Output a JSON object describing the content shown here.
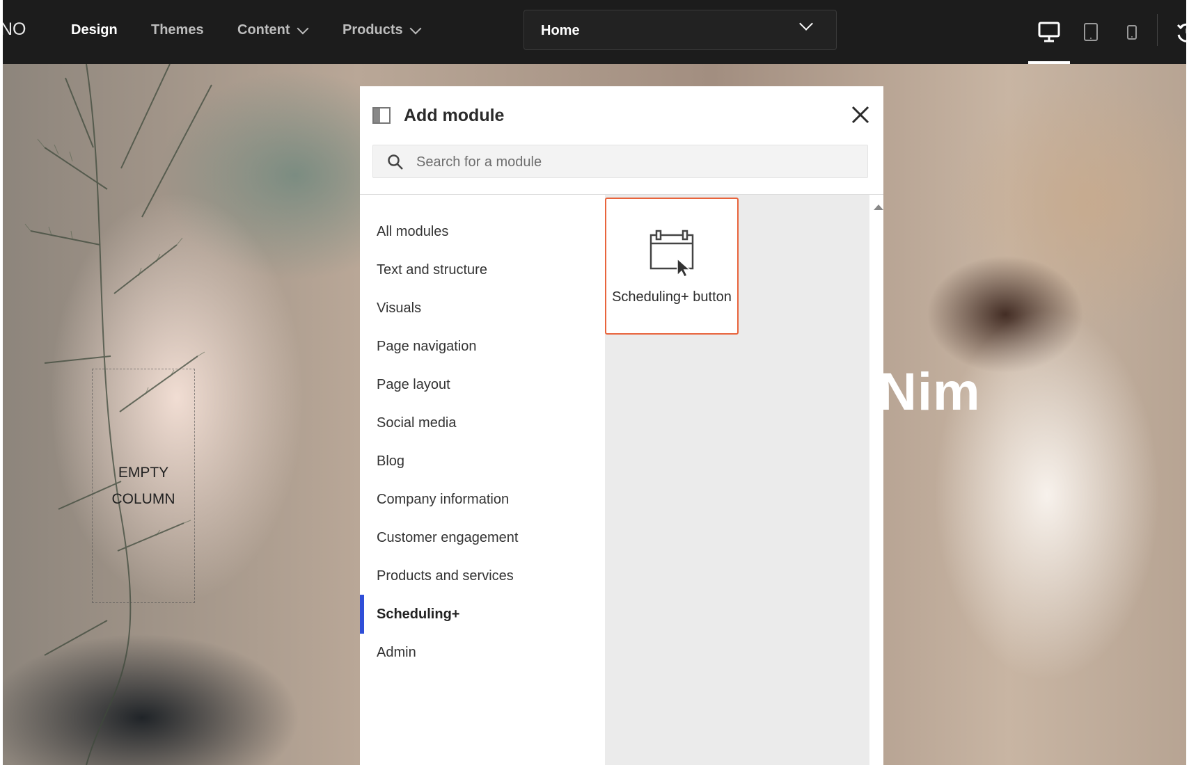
{
  "topbar": {
    "brand": "NO",
    "nav": [
      {
        "label": "Design",
        "active": true,
        "dropdown": false
      },
      {
        "label": "Themes",
        "active": false,
        "dropdown": false
      },
      {
        "label": "Content",
        "active": false,
        "dropdown": true
      },
      {
        "label": "Products",
        "active": false,
        "dropdown": true
      }
    ],
    "page_select": {
      "value": "Home",
      "icon": "chevron-down-icon"
    },
    "devices": [
      {
        "name": "desktop-icon",
        "active": true
      },
      {
        "name": "tablet-icon",
        "active": false
      },
      {
        "name": "mobile-icon",
        "active": false
      }
    ],
    "history_icon": "history-icon"
  },
  "canvas": {
    "empty_column_label": "EMPTY COLUMN",
    "hero_text": "Nim"
  },
  "modal": {
    "title": "Add module",
    "panel_icon": "panel-toggle-icon",
    "close_icon": "close-icon",
    "search": {
      "placeholder": "Search for a module",
      "value": ""
    },
    "categories": [
      {
        "label": "All modules",
        "active": false
      },
      {
        "label": "Text and structure",
        "active": false
      },
      {
        "label": "Visuals",
        "active": false
      },
      {
        "label": "Page navigation",
        "active": false
      },
      {
        "label": "Page layout",
        "active": false
      },
      {
        "label": "Social media",
        "active": false
      },
      {
        "label": "Blog",
        "active": false
      },
      {
        "label": "Company information",
        "active": false
      },
      {
        "label": "Customer engagement",
        "active": false
      },
      {
        "label": "Products and services",
        "active": false
      },
      {
        "label": "Scheduling+",
        "active": true
      },
      {
        "label": "Admin",
        "active": false
      }
    ],
    "modules": [
      {
        "label": "Scheduling+ button",
        "icon": "calendar-cursor-icon",
        "highlighted": true
      }
    ]
  },
  "colors": {
    "topbar_bg": "#1c1c1c",
    "active_category_accent": "#2f4ed8",
    "card_highlight_border": "#e8643c",
    "results_bg": "#ebebeb"
  }
}
